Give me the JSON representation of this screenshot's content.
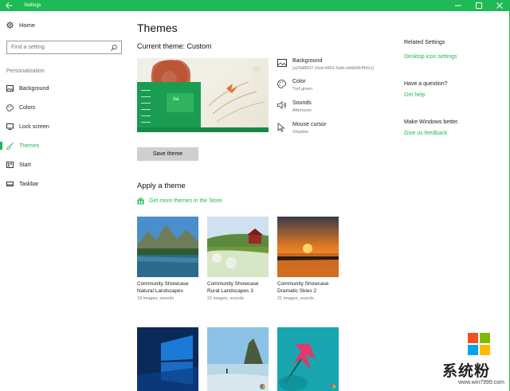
{
  "window": {
    "title": "Settings"
  },
  "sidebar": {
    "home_label": "Home",
    "search_placeholder": "Find a setting",
    "section_label": "Personalization",
    "items": [
      {
        "label": "Background",
        "icon": "picture-icon"
      },
      {
        "label": "Colors",
        "icon": "palette-icon"
      },
      {
        "label": "Lock screen",
        "icon": "monitor-icon"
      },
      {
        "label": "Themes",
        "icon": "brush-icon",
        "active": true
      },
      {
        "label": "Start",
        "icon": "start-icon"
      },
      {
        "label": "Taskbar",
        "icon": "taskbar-icon"
      }
    ]
  },
  "main": {
    "title": "Themes",
    "current_theme": "Current theme: Custom",
    "preview_tile_label": "Aa",
    "properties": [
      {
        "name": "Background",
        "value": "{a29d8937-1baf-4801-9afe-eb6b5fcf941c}",
        "icon": "picture-icon"
      },
      {
        "name": "Color",
        "value": "Turf green",
        "icon": "palette-icon"
      },
      {
        "name": "Sounds",
        "value": "Afternoon",
        "icon": "speaker-icon"
      },
      {
        "name": "Mouse cursor",
        "value": "Shadow",
        "icon": "cursor-icon"
      }
    ],
    "save_button": "Save theme",
    "apply_title": "Apply a theme",
    "store_link": "Get more themes in the Store",
    "themes": [
      {
        "line1": "Community Showcase",
        "line2": "Natural Landscapes",
        "meta": "19 images, sounds"
      },
      {
        "line1": "Community Showcase",
        "line2": "Rural Landscapes 3",
        "meta": "21 images, sounds"
      },
      {
        "line1": "Community Showcase",
        "line2": "Dramatic Skies 2",
        "meta": "21 images, sounds"
      }
    ]
  },
  "related": {
    "heading": "Related Settings",
    "link": "Desktop icon settings",
    "question_heading": "Have a question?",
    "help_link": "Get help",
    "better_heading": "Make Windows better.",
    "feedback_link": "Give us feedback"
  },
  "watermark": {
    "text": "系统粉",
    "url": "www.win7999.com"
  },
  "colors": {
    "accent": "#1fb955",
    "text_muted": "#777777",
    "button_bg": "#cfcfcf"
  }
}
